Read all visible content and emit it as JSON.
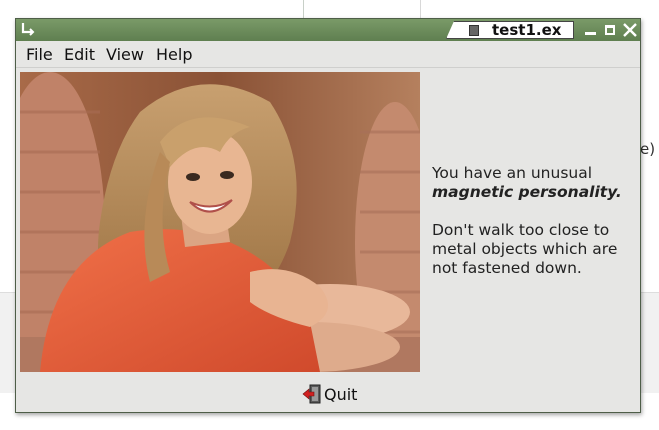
{
  "window": {
    "title": "test1.ex"
  },
  "menu": [
    "File",
    "Edit",
    "View",
    "Help"
  ],
  "message": {
    "line1": "You have an unusual",
    "line2": "magnetic personality.",
    "line3": "Don't walk too close to",
    "line4": "metal objects which are",
    "line5": "not fastened down."
  },
  "quit_button": {
    "label": "Quit"
  },
  "background_fragment": "e)",
  "colors": {
    "titlebar": "#6b8b5a",
    "window_bg": "#e6e6e4",
    "shirt": "#e35a3a"
  },
  "icons": [
    "app-icon",
    "document-icon",
    "minimize-icon",
    "maximize-icon",
    "close-icon",
    "quit-icon"
  ]
}
